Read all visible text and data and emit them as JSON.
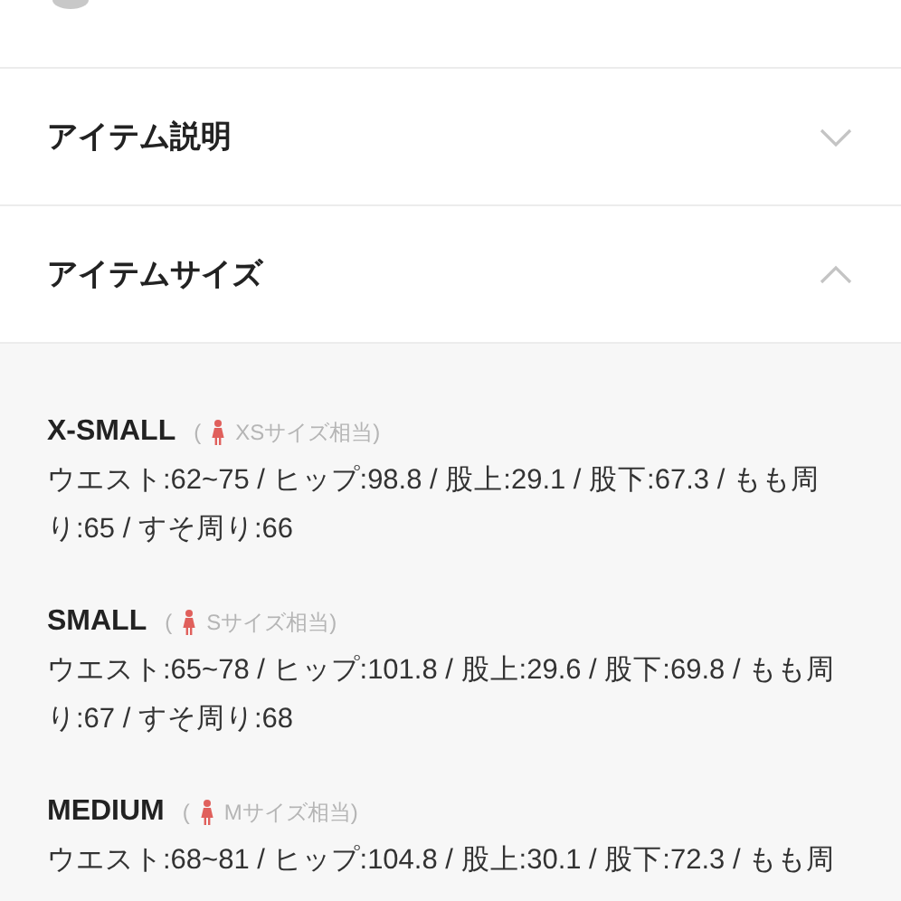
{
  "sections": [
    {
      "title": "アイテム説明",
      "expanded": false
    },
    {
      "title": "アイテムサイズ",
      "expanded": true,
      "sizes": [
        {
          "name": "X-SMALL",
          "note_open": "(",
          "note": "XSサイズ相当)",
          "spec": "ウエスト:62~75 / ヒップ:98.8 / 股上:29.1 / 股下:67.3 / もも周り:65 / すそ周り:66"
        },
        {
          "name": "SMALL",
          "note_open": "(",
          "note": "Sサイズ相当)",
          "spec": "ウエスト:65~78 / ヒップ:101.8 / 股上:29.6 / 股下:69.8 / もも周り:67 / すそ周り:68"
        },
        {
          "name": "MEDIUM",
          "note_open": "(",
          "note": "Mサイズ相当)",
          "spec": "ウエスト:68~81 / ヒップ:104.8 / 股上:30.1 / 股下:72.3 / もも周"
        }
      ]
    }
  ]
}
